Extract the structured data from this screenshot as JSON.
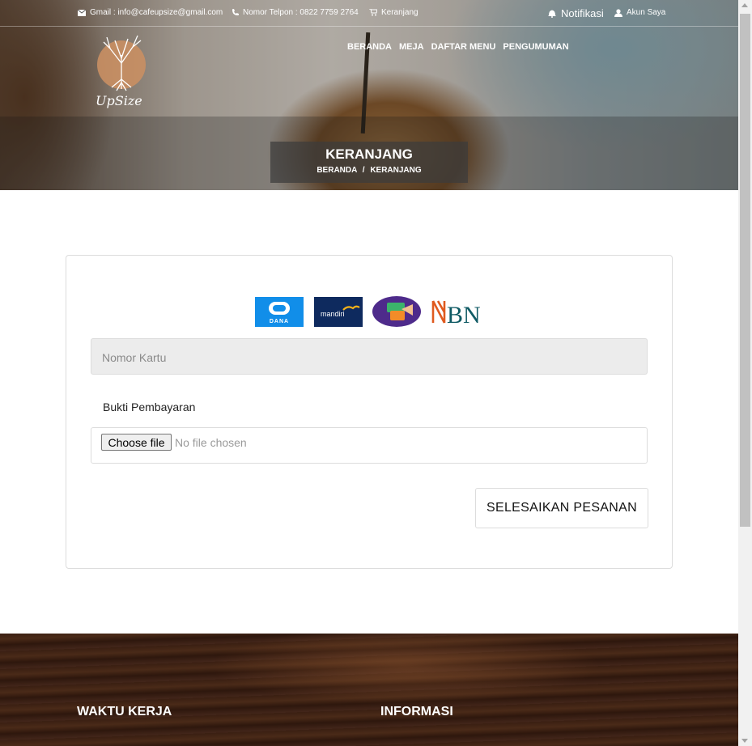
{
  "topbar": {
    "email": "Gmail : info@cafeupsize@gmail.com",
    "phone": "Nomor Telpon : 0822 7759 2764",
    "cart": "Keranjang",
    "notifications": "Notifikasi",
    "account": "Akun Saya"
  },
  "brand": {
    "logo_text": "UpSize"
  },
  "nav": {
    "items": [
      {
        "label": "BERANDA"
      },
      {
        "label": "MEJA"
      },
      {
        "label": "DAFTAR MENU"
      },
      {
        "label": "PENGUMUMAN"
      }
    ]
  },
  "page": {
    "title": "KERANJANG",
    "breadcrumb": {
      "home": "BERANDA",
      "separator": "/",
      "current": "KERANJANG"
    }
  },
  "payment": {
    "methods": [
      {
        "name": "DANA",
        "icon": "dana-logo"
      },
      {
        "name": "mandiri",
        "icon": "mandiri-logo"
      },
      {
        "name": "OVO",
        "icon": "ovo-logo"
      },
      {
        "name": "BNI",
        "icon": "bni-logo"
      }
    ],
    "card_number_placeholder": "Nomor Kartu",
    "proof_label": "Bukti Pembayaran",
    "choose_file_label": "Choose file",
    "no_file_text": "No file chosen",
    "submit_label": "SELESAIKAN PESANAN"
  },
  "footer": {
    "working_hours_title": "WAKTU KERJA",
    "info_title": "INFORMASI"
  },
  "colors": {
    "dana": "#118ee9",
    "mandiri": "#0e2a5e",
    "bni_orange": "#e05a1f",
    "bni_teal": "#0f5a64"
  }
}
